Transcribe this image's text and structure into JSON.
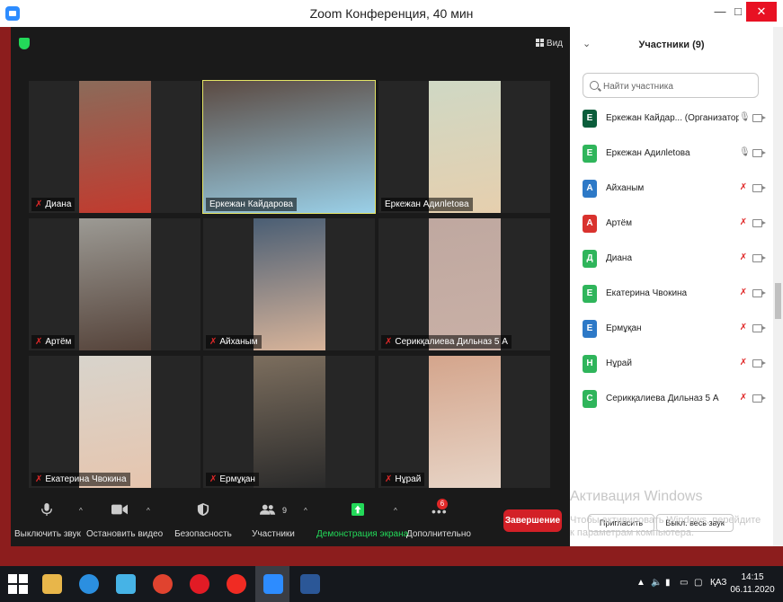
{
  "window": {
    "title": "Zoom Конференция, 40 мин",
    "minimize": "—",
    "maximize": "□",
    "close": "✕"
  },
  "video": {
    "view_label": "Вид",
    "tiles": [
      {
        "name": "Диана",
        "muted": true,
        "active": false,
        "colors": [
          "#8b6b5a",
          "#c23a2e"
        ]
      },
      {
        "name": "Еркежан Кайдарова",
        "muted": false,
        "active": true,
        "colors": [
          "#5b4a42",
          "#9ad0e8"
        ]
      },
      {
        "name": "Еркежан Адилletова",
        "muted": false,
        "active": false,
        "colors": [
          "#cfd8c4",
          "#e6cfae"
        ]
      },
      {
        "name": "Артём",
        "muted": true,
        "active": false,
        "colors": [
          "#9c9a94",
          "#55433a"
        ]
      },
      {
        "name": "Айханым",
        "muted": true,
        "active": false,
        "colors": [
          "#4a5e74",
          "#d8b49a"
        ]
      },
      {
        "name": "Серикқалиева Дильназ 5 А",
        "muted": true,
        "active": false,
        "colors": [
          "#bfa8a0",
          "#c9b0a6"
        ]
      },
      {
        "name": "Екатерина Чвокина",
        "muted": true,
        "active": false,
        "colors": [
          "#d8d4cc",
          "#e6c5ae"
        ]
      },
      {
        "name": "Ермұқан",
        "muted": true,
        "active": false,
        "colors": [
          "#7c6e5e",
          "#2a2a2a"
        ]
      },
      {
        "name": "Нұрай",
        "muted": true,
        "active": false,
        "colors": [
          "#d4a58c",
          "#e7d4c6"
        ]
      }
    ]
  },
  "controls": {
    "mute": "Выключить звук",
    "video": "Остановить видео",
    "security": "Безопасность",
    "participants": "Участники",
    "participants_count": "9",
    "share": "Демонстрация экрана",
    "more": "Дополнительно",
    "more_badge": "6",
    "end": "Завершение"
  },
  "panel": {
    "title": "Участники (9)",
    "search_placeholder": "Найти участника",
    "invite": "Пригласить",
    "mute_all": "Выкл. весь звук",
    "participants": [
      {
        "initial": "Е",
        "name": "Еркежан Кайдар... (Организатор, я)",
        "color": "#0b5d3b",
        "mic": "on"
      },
      {
        "initial": "Е",
        "name": "Еркежан Адилletова",
        "color": "#2fb55b",
        "mic": "on"
      },
      {
        "initial": "А",
        "name": "Айханым",
        "color": "#2d79c7",
        "mic": "off"
      },
      {
        "initial": "А",
        "name": "Артём",
        "color": "#d9322e",
        "mic": "off"
      },
      {
        "initial": "Д",
        "name": "Диана",
        "color": "#2fb55b",
        "mic": "off"
      },
      {
        "initial": "Е",
        "name": "Екатерина Чвокина",
        "color": "#2fb55b",
        "mic": "off"
      },
      {
        "initial": "Е",
        "name": "Ермұқан",
        "color": "#2d79c7",
        "mic": "off"
      },
      {
        "initial": "Н",
        "name": "Нұрай",
        "color": "#2fb55b",
        "mic": "off"
      },
      {
        "initial": "С",
        "name": "Серикқалиева Дильназ 5 А",
        "color": "#2fb55b",
        "mic": "off"
      }
    ]
  },
  "watermark": {
    "line1": "Активация Windows",
    "line2": "Чтобы активировать Windows, перейдите к параметрам компьютера."
  },
  "taskbar": {
    "lang": "ҚАЗ",
    "time": "14:15",
    "date": "06.11.2020",
    "apps": [
      {
        "icon": "windows-start-icon",
        "color": "#ffffff"
      },
      {
        "icon": "file-explorer-icon",
        "color": "#e8b64a"
      },
      {
        "icon": "internet-explorer-icon",
        "color": "#2b8fe0"
      },
      {
        "icon": "app-icon",
        "color": "#46b3e6"
      },
      {
        "icon": "chrome-icon",
        "color": "#e0432f"
      },
      {
        "icon": "opera-icon",
        "color": "#e21b25"
      },
      {
        "icon": "yandex-icon",
        "color": "#f02b23"
      },
      {
        "icon": "zoom-icon",
        "color": "#2d8cff"
      },
      {
        "icon": "word-icon",
        "color": "#2b5797"
      }
    ]
  }
}
